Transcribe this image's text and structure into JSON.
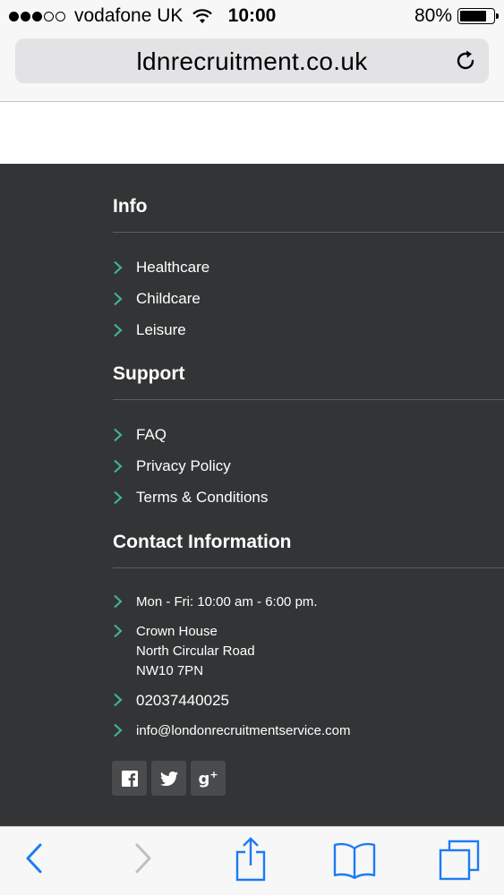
{
  "status_bar": {
    "carrier": "vodafone UK",
    "time": "10:00",
    "battery": "80%",
    "signal_bars_filled": 3,
    "signal_bars_total": 5,
    "battery_level": 0.8
  },
  "browser": {
    "url": "ldnrecruitment.co.uk",
    "icons": {
      "reload": "reload-icon",
      "back": "back-arrow-icon",
      "forward": "forward-arrow-icon",
      "share": "share-icon",
      "bookmarks": "bookmarks-icon",
      "tabs": "tabs-icon"
    }
  },
  "footer": {
    "info": {
      "title": "Info",
      "links": [
        "Healthcare",
        "Childcare",
        "Leisure"
      ]
    },
    "support": {
      "title": "Support",
      "links": [
        "FAQ",
        "Privacy Policy",
        "Terms & Conditions"
      ]
    },
    "contact": {
      "title": "Contact Information",
      "hours": "Mon - Fri: 10:00 am - 6:00 pm.",
      "address": [
        "Crown House",
        "North Circular Road",
        "NW10 7PN"
      ],
      "phone": "02037440025",
      "email": "info@londonrecruitmentservice.com"
    },
    "social": [
      "facebook-icon",
      "twitter-icon",
      "google-plus-icon"
    ]
  },
  "colors": {
    "footer_bg": "#333435",
    "accent_chevron": "#3fb58f",
    "ios_blue": "#1c7cf4",
    "chrome_bg": "#f7f7f7"
  }
}
